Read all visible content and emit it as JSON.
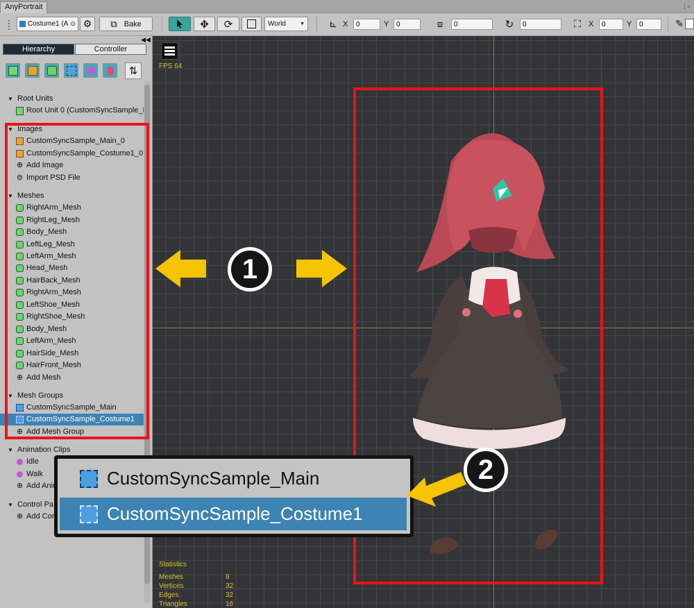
{
  "window": {
    "tab_title": "AnyPortrait"
  },
  "toolbar": {
    "mesh_group_select": "Costume1 (A",
    "bake_label": "Bake",
    "space_select": "World",
    "position_x_label": "X",
    "position_x_value": "0",
    "position_y_label": "Y",
    "position_y_value": "0",
    "depth_value": "0",
    "rotation_value": "0",
    "scale_x_label": "X",
    "scale_x_value": "0",
    "scale_y_label": "Y",
    "scale_y_value": "0"
  },
  "panel": {
    "tabs": [
      {
        "label": "Hierarchy"
      },
      {
        "label": "Controller"
      }
    ],
    "sections": {
      "root_units": {
        "title": "Root Units",
        "items": [
          {
            "label": "Root Unit 0 (CustomSyncSample_M",
            "icon": "root-unit-icon"
          }
        ]
      },
      "images": {
        "title": "Images",
        "items": [
          {
            "label": "CustomSyncSample_Main_0",
            "icon": "image-icon"
          },
          {
            "label": "CustomSyncSample_Costume1_0",
            "icon": "image-icon"
          },
          {
            "label": "Add Image",
            "icon": "add-icon"
          },
          {
            "label": "Import PSD File",
            "icon": "psd-icon"
          }
        ]
      },
      "meshes": {
        "title": "Meshes",
        "items": [
          {
            "label": "RightArm_Mesh"
          },
          {
            "label": "RightLeg_Mesh"
          },
          {
            "label": "Body_Mesh"
          },
          {
            "label": "LeftLeg_Mesh"
          },
          {
            "label": "LeftArm_Mesh"
          },
          {
            "label": "Head_Mesh"
          },
          {
            "label": "HairBack_Mesh"
          },
          {
            "label": "RightArm_Mesh"
          },
          {
            "label": "LeftShoe_Mesh"
          },
          {
            "label": "RightShoe_Mesh"
          },
          {
            "label": "Body_Mesh"
          },
          {
            "label": "LeftArm_Mesh"
          },
          {
            "label": "HairSide_Mesh"
          },
          {
            "label": "HairFront_Mesh"
          },
          {
            "label": "Add Mesh"
          }
        ]
      },
      "mesh_groups": {
        "title": "Mesh Groups",
        "items": [
          {
            "label": "CustomSyncSample_Main"
          },
          {
            "label": "CustomSyncSample_Costume1",
            "selected": true
          },
          {
            "label": "Add Mesh Group"
          }
        ]
      },
      "animation_clips": {
        "title": "Animation Clips",
        "items": [
          {
            "label": "Idle"
          },
          {
            "label": "Walk"
          },
          {
            "label": "Add Anim"
          }
        ]
      },
      "control_params": {
        "title": "Control Pa",
        "items": [
          {
            "label": "Add Con"
          }
        ]
      }
    }
  },
  "viewport": {
    "fps": "FPS 64",
    "statistics": {
      "title": "Statistics",
      "rows": [
        {
          "label": "Meshes",
          "value": "8"
        },
        {
          "label": "Vertices",
          "value": "32"
        },
        {
          "label": "Edges",
          "value": "32"
        },
        {
          "label": "Triangles",
          "value": "16"
        }
      ]
    }
  },
  "annotations": {
    "badge_1": "1",
    "badge_2": "2",
    "zoom_items": [
      {
        "label": "CustomSyncSample_Main"
      },
      {
        "label": "CustomSyncSample_Costume1",
        "selected": true
      }
    ],
    "colors": {
      "frame": "#e8141a",
      "arrow": "#f6c400",
      "selection": "#3d83b3",
      "teal": "#3aa39e"
    }
  }
}
